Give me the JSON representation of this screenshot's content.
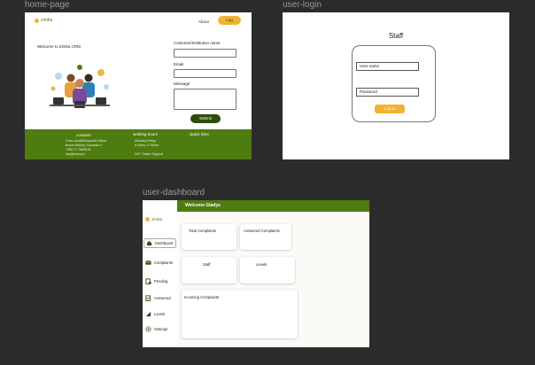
{
  "frames": {
    "home": "home-page",
    "login": "user-login",
    "dashboard": "user-dashboard"
  },
  "home": {
    "logo": "zimba",
    "nav_about": "About",
    "nav_login": "Log",
    "welcome": "Welcome to Zimba CRM",
    "hero_icon": "team-illustration",
    "form": {
      "customer_label": "Customer/Institution name",
      "email_label": "Email",
      "message_label": "Message",
      "submit": "Submit"
    },
    "footer": {
      "contacts_title": "contacts",
      "contacts_lines": [
        "Cues Jacq08/Asyando Wash",
        "Boxes Aftekiy, Kampala U",
        "+256 77 7909918",
        "info@zimsy.io"
      ],
      "hours_title": "working hours",
      "hours_lines": [
        "Monday-Friday",
        "8:00hrs-17:00hrs",
        "",
        "24/7 Online Support"
      ],
      "links_title": "Quick links"
    }
  },
  "login": {
    "title": "Staff",
    "username_placeholder": "User name",
    "password_placeholder": "Password",
    "login_button": "Log in"
  },
  "dashboard": {
    "logo": "zimba",
    "welcome": "Welcome Gladys",
    "nav": [
      {
        "label": "Dashboard",
        "icon": "home-icon"
      },
      {
        "label": "Complaints",
        "icon": "mail-icon"
      },
      {
        "label": "Pending",
        "icon": "clipboard-icon"
      },
      {
        "label": "Answered",
        "icon": "check-list-icon"
      },
      {
        "label": "Levels",
        "icon": "signal-icon"
      },
      {
        "label": "Settings",
        "icon": "gear-icon"
      }
    ],
    "cards": {
      "total": "Total Complaints",
      "answered": "Answered Complaints",
      "staff": "Staff",
      "levels": "Levels",
      "incoming": "Incoming Complaints"
    }
  },
  "colors": {
    "green": "#4e7c10",
    "dark_green": "#2d4d0b",
    "amber": "#f2b233",
    "canvas": "#2b2b2b"
  }
}
